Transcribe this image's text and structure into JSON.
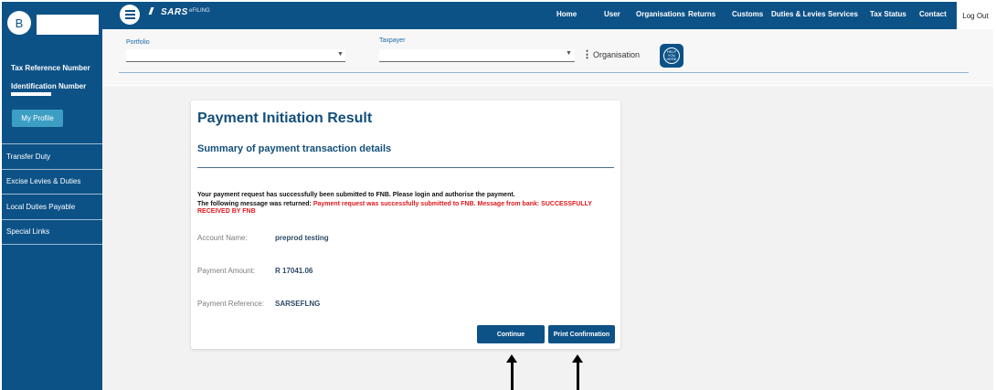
{
  "header": {
    "logo_text": "SARS",
    "efiling_text": "eFILING",
    "nav": [
      "Home",
      "User",
      "Organisations",
      "Returns",
      "Customs",
      "Duties & Levies",
      "Services",
      "Tax Status",
      "Contact"
    ],
    "logout": "Log Out"
  },
  "sidebar": {
    "avatar_initial": "B",
    "tax_reference_label": "Tax Reference Number",
    "identification_label": "Identification Number",
    "my_profile": "My Profile",
    "items": [
      "Transfer Duty",
      "Excise Levies & Duties",
      "Local Duties Payable",
      "Special Links"
    ]
  },
  "filters": {
    "portfolio_label": "Portfolio",
    "taxpayer_label": "Taxpayer",
    "organisation_label": "Organisation",
    "help_badge_text": "HELP YOU HERE"
  },
  "result": {
    "title": "Payment Initiation Result",
    "subtitle": "Summary of payment transaction details",
    "message_line1": "Your payment request has successfully been submitted to FNB. Please login and authorise the payment.",
    "message_prefix": "The following message was returned: ",
    "message_bank": "Payment request was successfully submitted to FNB. Message from bank: SUCCESSFULLY RECEIVED BY FNB",
    "fields": [
      {
        "label": "Account Name:",
        "value": "preprod testing"
      },
      {
        "label": "Payment Amount:",
        "value": "R 17041.06"
      },
      {
        "label": "Payment Reference:",
        "value": "SARSEFLNG"
      }
    ],
    "continue_label": "Continue",
    "print_label": "Print Confirmation"
  }
}
